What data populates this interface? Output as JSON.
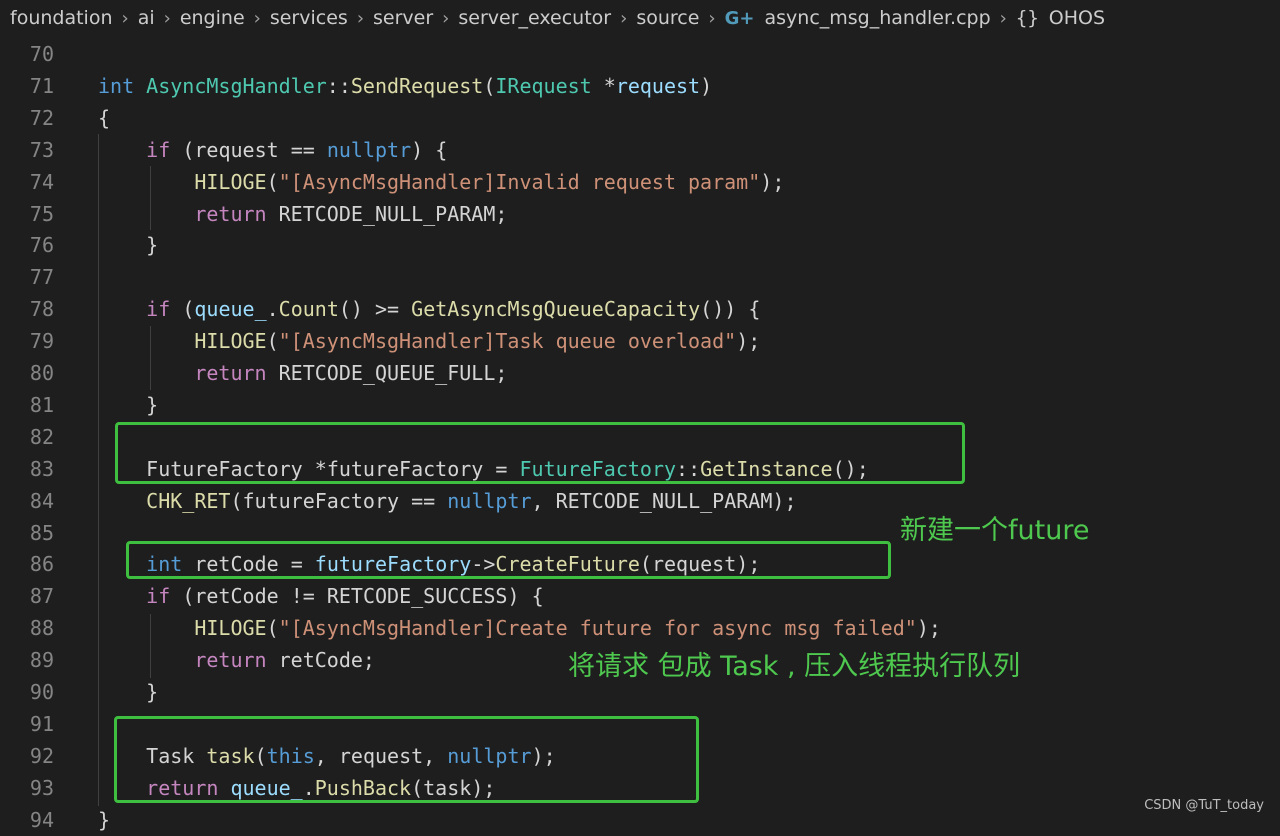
{
  "breadcrumb": {
    "items": [
      "foundation",
      "ai",
      "engine",
      "services",
      "server",
      "server_executor",
      "source"
    ],
    "file_icon": "cpp-file-icon",
    "file": "async_msg_handler.cpp",
    "namespace_icon": "braces-icon",
    "namespace": "OHOS",
    "separator": "›"
  },
  "editor": {
    "lines": [
      {
        "n": "70",
        "code": ""
      },
      {
        "n": "71",
        "code": "int AsyncMsgHandler::SendRequest(IRequest *request)"
      },
      {
        "n": "72",
        "code": "{"
      },
      {
        "n": "73",
        "code": "    if (request == nullptr) {"
      },
      {
        "n": "74",
        "code": "        HILOGE(\"[AsyncMsgHandler]Invalid request param\");"
      },
      {
        "n": "75",
        "code": "        return RETCODE_NULL_PARAM;"
      },
      {
        "n": "76",
        "code": "    }"
      },
      {
        "n": "77",
        "code": ""
      },
      {
        "n": "78",
        "code": "    if (queue_.Count() >= GetAsyncMsgQueueCapacity()) {"
      },
      {
        "n": "79",
        "code": "        HILOGE(\"[AsyncMsgHandler]Task queue overload\");"
      },
      {
        "n": "80",
        "code": "        return RETCODE_QUEUE_FULL;"
      },
      {
        "n": "81",
        "code": "    }"
      },
      {
        "n": "82",
        "code": ""
      },
      {
        "n": "83",
        "code": "    FutureFactory *futureFactory = FutureFactory::GetInstance();"
      },
      {
        "n": "84",
        "code": "    CHK_RET(futureFactory == nullptr, RETCODE_NULL_PARAM);"
      },
      {
        "n": "85",
        "code": ""
      },
      {
        "n": "86",
        "code": "    int retCode = futureFactory->CreateFuture(request);"
      },
      {
        "n": "87",
        "code": "    if (retCode != RETCODE_SUCCESS) {"
      },
      {
        "n": "88",
        "code": "        HILOGE(\"[AsyncMsgHandler]Create future for async msg failed\");"
      },
      {
        "n": "89",
        "code": "        return retCode;"
      },
      {
        "n": "90",
        "code": "    }"
      },
      {
        "n": "91",
        "code": ""
      },
      {
        "n": "92",
        "code": "    Task task(this, request, nullptr);"
      },
      {
        "n": "93",
        "code": "    return queue_.PushBack(task);"
      },
      {
        "n": "94",
        "code": "}"
      }
    ]
  },
  "annotations": {
    "future_note": "新建一个future",
    "task_note": "将请求 包成 Task , 压入线程执行队列"
  },
  "watermark": "CSDN @TuT_today",
  "colors": {
    "background": "#1e1e1e",
    "annotation_green": "#3fbf3f",
    "keyword": "#569cd6",
    "control": "#c586c0",
    "function": "#dcdcaa",
    "type": "#4ec9b0",
    "variable": "#9cdcfe",
    "string": "#ce9178",
    "line_number": "#858585"
  }
}
